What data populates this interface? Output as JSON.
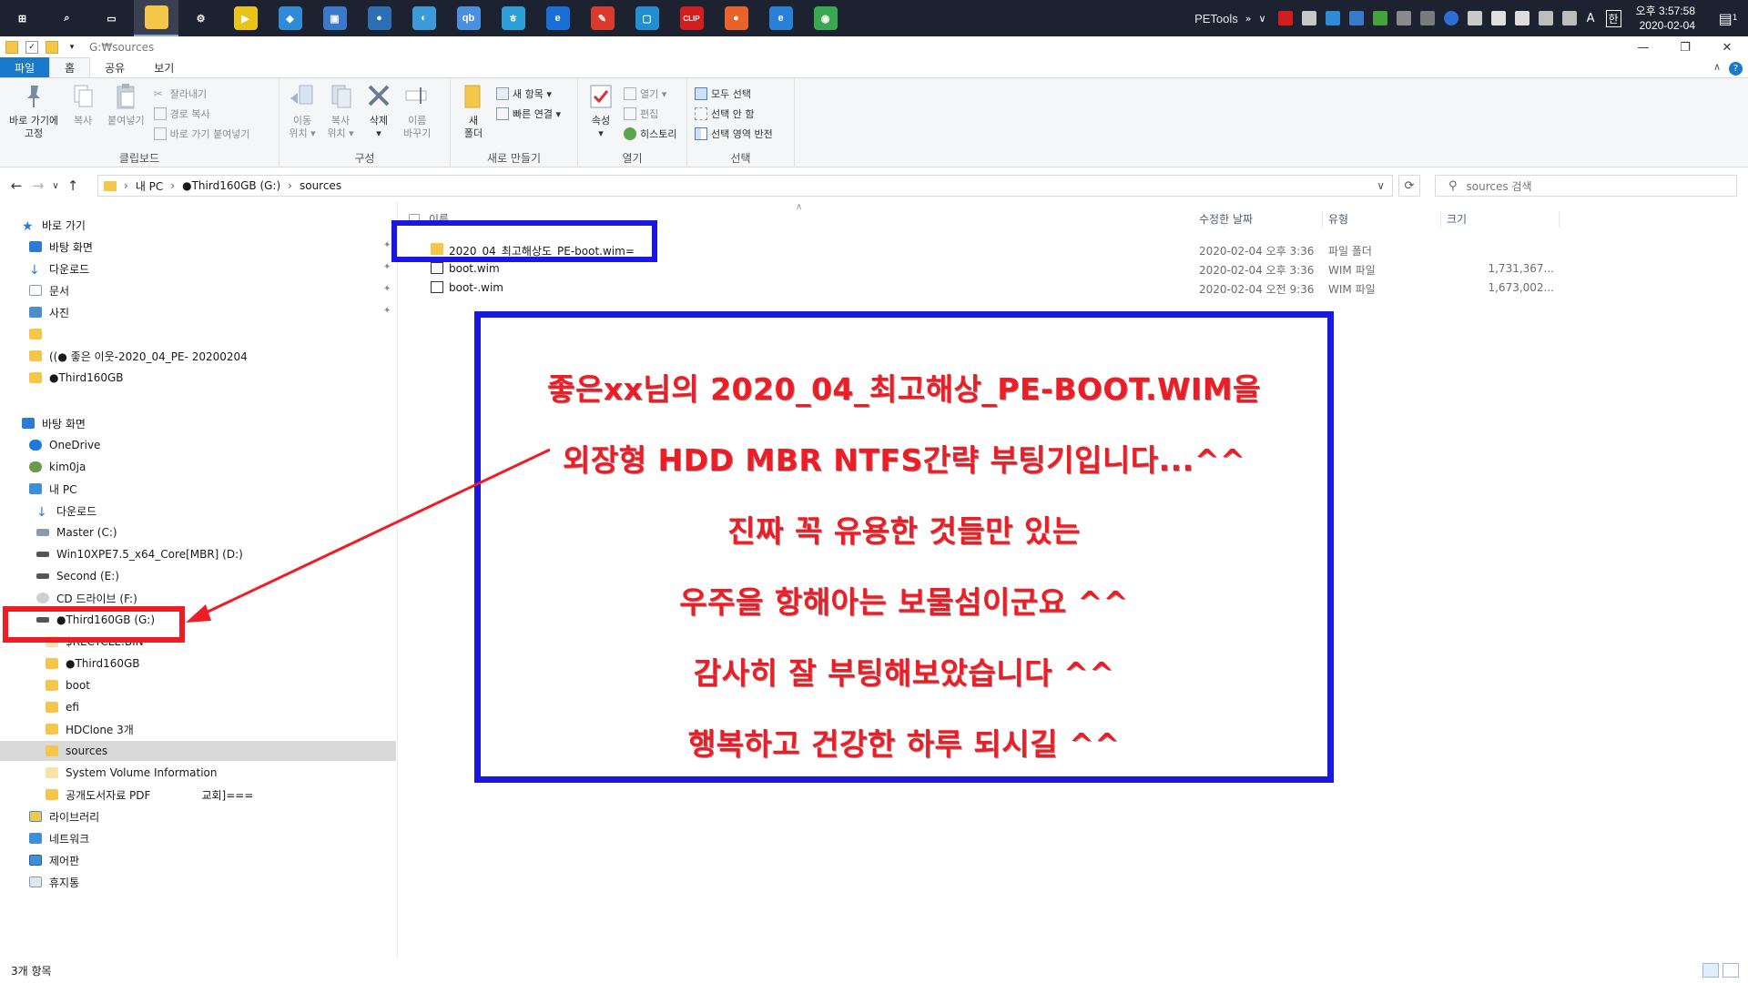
{
  "taskbar": {
    "tray_label": "PETools",
    "clock_time": "오후 3:57:58",
    "clock_date": "2020-02-04",
    "notification_count": "1",
    "tray_ime": "A",
    "tray_lang": "한",
    "apps": [
      {
        "name": "start-icon",
        "color": "#1d2230",
        "glyph": "⊞"
      },
      {
        "name": "search-icon",
        "color": "#1d2230",
        "glyph": "⌕"
      },
      {
        "name": "task-view-icon",
        "color": "#1d2230",
        "glyph": "▭"
      },
      {
        "name": "file-explorer-icon",
        "color": "#f4c74b",
        "glyph": ""
      },
      {
        "name": "settings-icon",
        "color": "#1d2230",
        "glyph": "⚙"
      },
      {
        "name": "potplayer-icon",
        "color": "#e9c21a",
        "glyph": "▶"
      },
      {
        "name": "app-icon",
        "color": "#2f8bd6",
        "glyph": "◆"
      },
      {
        "name": "network-tool-icon",
        "color": "#3a78c9",
        "glyph": "▣"
      },
      {
        "name": "globe-icon",
        "color": "#2d6fb5",
        "glyph": "●"
      },
      {
        "name": "disk-tool-icon",
        "color": "#3b9bd9",
        "glyph": "◐"
      },
      {
        "name": "qbittorrent-icon",
        "color": "#4a8fe0",
        "glyph": "qb"
      },
      {
        "name": "hangul-icon",
        "color": "#2ea0d8",
        "glyph": "ㅎ"
      },
      {
        "name": "edge-icon",
        "color": "#1a6fd6",
        "glyph": "e"
      },
      {
        "name": "tool-icon",
        "color": "#d93a2c",
        "glyph": "✎"
      },
      {
        "name": "app2-icon",
        "color": "#1f8fcf",
        "glyph": "▢"
      },
      {
        "name": "clip-icon",
        "color": "#d41e1e",
        "glyph": "CLIP"
      },
      {
        "name": "firefox-icon",
        "color": "#e8622a",
        "glyph": "●"
      },
      {
        "name": "internet-explorer-icon",
        "color": "#2a7fd8",
        "glyph": "e"
      },
      {
        "name": "chrome-icon",
        "color": "#3aa853",
        "glyph": "◉"
      }
    ]
  },
  "titlebar": {
    "path": "G:₩sources"
  },
  "ribbon_tabs": [
    "파일",
    "홈",
    "공유",
    "보기"
  ],
  "ribbon": {
    "clipboard": {
      "label": "클립보드",
      "pin": "바로 가기에\n고정",
      "copy": "복사",
      "paste": "붙여넣기",
      "cut": "잘라내기",
      "copy_path": "경로 복사",
      "paste_shortcut": "바로 가기 붙여넣기"
    },
    "organize": {
      "label": "구성",
      "move_to": "이동\n위치 ▾",
      "copy_to": "복사\n위치 ▾",
      "delete": "삭제\n▾",
      "rename": "이름\n바꾸기"
    },
    "new": {
      "label": "새로 만들기",
      "new_folder": "새\n폴더",
      "new_item": "새 항목 ▾",
      "easy_access": "빠른 연결 ▾"
    },
    "open": {
      "label": "열기",
      "properties": "속성\n▾",
      "open": "열기 ▾",
      "edit": "편집",
      "history": "히스토리"
    },
    "select": {
      "label": "선택",
      "select_all": "모두 선택",
      "select_none": "선택 안 함",
      "invert": "선택 영역 반전"
    }
  },
  "address": {
    "crumbs": [
      "내 PC",
      "●Third160GB (G:)",
      "sources"
    ],
    "search_placeholder": "sources 검색"
  },
  "nav": {
    "quick_access": "바로 가기",
    "desktop": "바탕 화면",
    "downloads": "다운로드",
    "documents": "문서",
    "pictures": "사진",
    "folder_good": "((● 좋은 이웃-2020_04_PE- 20200204",
    "folder_third": "●Third160GB",
    "desktop2": "바탕 화면",
    "onedrive": "OneDrive",
    "user": "kim0ja",
    "this_pc": "내 PC",
    "downloads2": "다운로드",
    "drive_c": "Master (C:)",
    "drive_d": "Win10XPE7.5_x64_Core[MBR] (D:)",
    "drive_e": "Second (E:)",
    "drive_f": "CD 드라이브 (F:)",
    "drive_g": "●Third160GB (G:)",
    "recycle_bin_folder": "$RECYCLE.BIN",
    "g_third": "●Third160GB",
    "boot": "boot",
    "efi": "efi",
    "hdclone": "HDClone 3개",
    "sources": "sources",
    "svi": "System Volume Information",
    "pdf": "공개도서자료 PDF",
    "pdf_extra": "교회]===",
    "library": "라이브러리",
    "network": "네트워크",
    "control_panel": "제어판",
    "recycle_bin": "휴지통"
  },
  "columns": {
    "name": "이름",
    "date": "수정한 날짜",
    "type": "유형",
    "size": "크기"
  },
  "files": [
    {
      "name": "2020_04_최고해상도_PE-boot.wim=",
      "date": "2020-02-04 오후 3:36",
      "type": "파일 폴더",
      "size": "",
      "kind": "folder"
    },
    {
      "name": "boot.wim",
      "date": "2020-02-04 오후 3:36",
      "type": "WIM 파일",
      "size": "1,731,367...",
      "kind": "wim"
    },
    {
      "name": "boot-.wim",
      "date": "2020-02-04 오전 9:36",
      "type": "WIM 파일",
      "size": "1,673,002...",
      "kind": "wim"
    }
  ],
  "status": {
    "count": "3개 항목"
  },
  "annotation": {
    "lines": [
      "좋은xx님의 2020_04_최고해상_PE-BOOT.WIM을",
      "외장형 HDD MBR NTFS간략 부팅기입니다...^^",
      "진짜  꼭 유용한 것들만 있는",
      "우주을 항해아는 보물섬이군요 ^^",
      "감사히 잘 부팅해보았습니다 ^^",
      "행복하고 건강한 하루 되시길 ^^"
    ]
  },
  "colors": {
    "annotation_red": "#ee1c25",
    "annotation_blue": "#1a17e0",
    "accent": "#1979ca",
    "folder": "#f4c74b",
    "taskbar": "#1d2230"
  }
}
